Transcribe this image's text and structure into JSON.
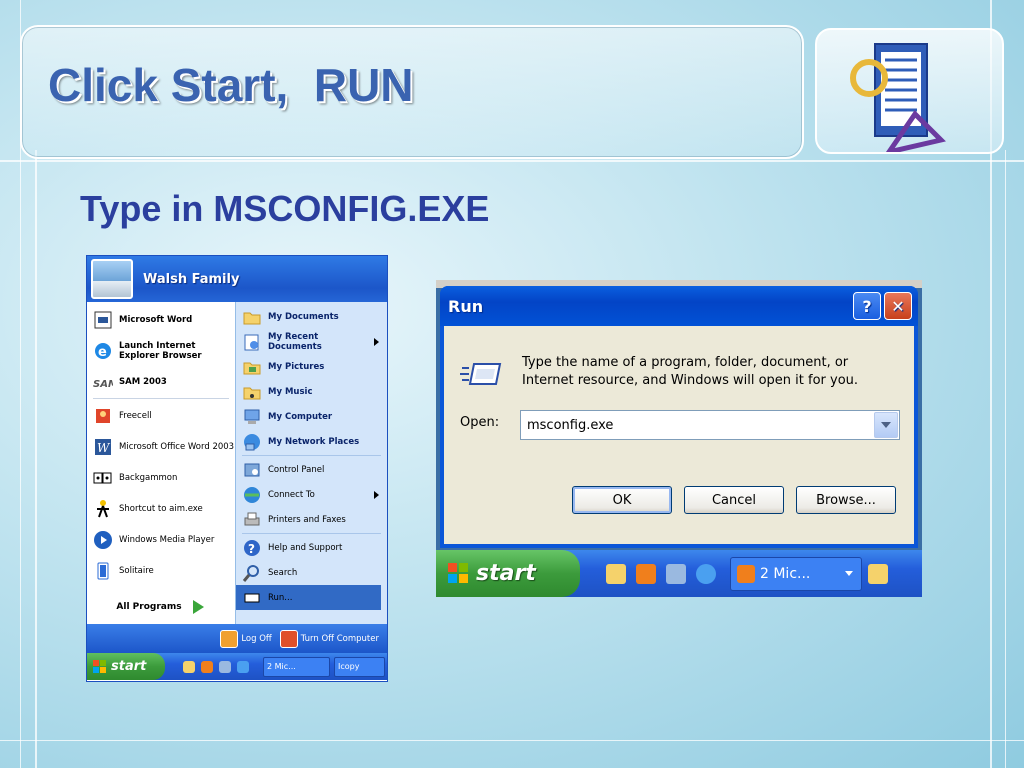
{
  "slide": {
    "title": "Click Start,  RUN",
    "subtitle": "Type in MSCONFIG.EXE"
  },
  "start_menu": {
    "user": "Walsh Family",
    "left_items": [
      {
        "label": "Microsoft Word",
        "icon": "word-doc-icon",
        "bold": true
      },
      {
        "label": "Launch Internet Explorer Browser",
        "icon": "internet-explorer-icon",
        "bold": true
      },
      {
        "label": "SAM 2003",
        "icon": "sam-icon",
        "bold": true
      },
      {
        "label": "Freecell",
        "icon": "freecell-icon",
        "bold": false
      },
      {
        "label": "Microsoft Office Word 2003",
        "icon": "word-icon",
        "bold": false
      },
      {
        "label": "Backgammon",
        "icon": "backgammon-icon",
        "bold": false
      },
      {
        "label": "Shortcut to aim.exe",
        "icon": "aim-icon",
        "bold": false
      },
      {
        "label": "Windows Media Player",
        "icon": "media-player-icon",
        "bold": false
      },
      {
        "label": "Solitaire",
        "icon": "solitaire-icon",
        "bold": false
      }
    ],
    "all_programs": "All Programs",
    "right_items": [
      {
        "label": "My Documents",
        "icon": "folder-icon"
      },
      {
        "label": "My Recent Documents",
        "icon": "recent-docs-icon"
      },
      {
        "label": "My Pictures",
        "icon": "pictures-folder-icon"
      },
      {
        "label": "My Music",
        "icon": "music-folder-icon"
      },
      {
        "label": "My Computer",
        "icon": "computer-icon"
      },
      {
        "label": "My Network Places",
        "icon": "network-icon"
      },
      {
        "label": "Control Panel",
        "icon": "control-panel-icon"
      },
      {
        "label": "Connect To",
        "icon": "connect-icon"
      },
      {
        "label": "Printers and Faxes",
        "icon": "printer-icon"
      },
      {
        "label": "Help and Support",
        "icon": "help-icon"
      },
      {
        "label": "Search",
        "icon": "search-icon"
      },
      {
        "label": "Run...",
        "icon": "run-icon"
      }
    ],
    "log_off": "Log Off",
    "turn_off": "Turn Off Computer",
    "taskbar": {
      "start": "start",
      "task": "2 Mic...",
      "task2": "Icopy"
    }
  },
  "run_dialog": {
    "title": "Run",
    "description_line1": "Type the name of a program, folder, document, or",
    "description_line2": "Internet resource, and Windows will open it for you.",
    "open_label": "Open:",
    "open_value": "msconfig.exe",
    "ok": "OK",
    "cancel": "Cancel",
    "browse": "Browse...",
    "help_glyph": "?",
    "close_glyph": "✕"
  },
  "taskbar": {
    "start": "start",
    "task": "2 Mic..."
  }
}
